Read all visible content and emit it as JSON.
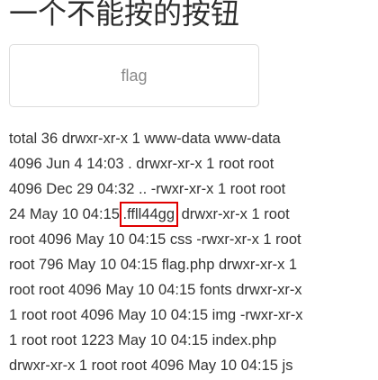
{
  "page": {
    "title": "一个不能按的按钮"
  },
  "button": {
    "label": "flag"
  },
  "listing": {
    "lines": [
      "total 36 drwxr-xr-x 1 www-data www-data",
      "4096 Jun 4 14:03 . drwxr-xr-x 1 root root",
      "4096 Dec 29 04:32 .. -rwxr-xr-x 1 root root"
    ],
    "line4_before": "24 May 10 04:15",
    "line4_highlight": ".ffll44gg",
    "line4_after": "drwxr-xr-x 1 root",
    "lines_rest": [
      "root 4096 May 10 04:15 css -rwxr-xr-x 1 root",
      "root 796 May 10 04:15 flag.php drwxr-xr-x 1",
      "root root 4096 May 10 04:15 fonts drwxr-xr-x",
      "1 root root 4096 May 10 04:15 img -rwxr-xr-x",
      "1 root root 1223 May 10 04:15 index.php",
      "drwxr-xr-x 1 root root 4096 May 10 04:15 js"
    ]
  },
  "annotation": {
    "color": "#e00000"
  }
}
